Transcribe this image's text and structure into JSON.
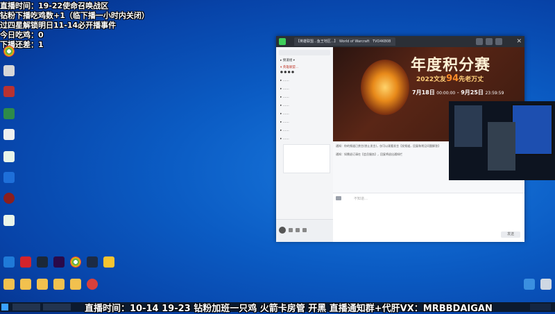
{
  "overlay": {
    "line1": "直播时间：19-22使命召唤战区",
    "line2": "钻粉下播吃鸡数+1（临下播一小时内关闭）",
    "line3": "过四星解锁明日11-14必开播事件",
    "line4": "今日吃鸡：0",
    "line5": "下播还差：1"
  },
  "ticker": "直播时间：10-14 19-23  钻粉加班一只鸡 火箭卡房管 开黑 直播通知群+代肝VX：MRBBDAIGAN",
  "window": {
    "tab1": "【英雄联盟...鱼王地区...】",
    "tab2": "World of Warcraft",
    "tab3": "TVO4K808"
  },
  "banner": {
    "title": "年度积分赛",
    "subtitle_prefix": "2022文友",
    "subtitle_num": "94",
    "subtitle_suffix": "先老万丈",
    "date_start": "7月18日",
    "time_start": "00:00:00",
    "date_end": "9月25日",
    "time_end": "23:59:59"
  },
  "chat": {
    "msg1": "通知：你的频道已禁言(禁止发言)，仅可以观看发言【发频道，回复和常见问题解答】",
    "msg2": "通知：如需退订请在【会员服务】，回复将退出通知栏"
  },
  "input_placeholder": "不知道…",
  "send_label": "发送"
}
